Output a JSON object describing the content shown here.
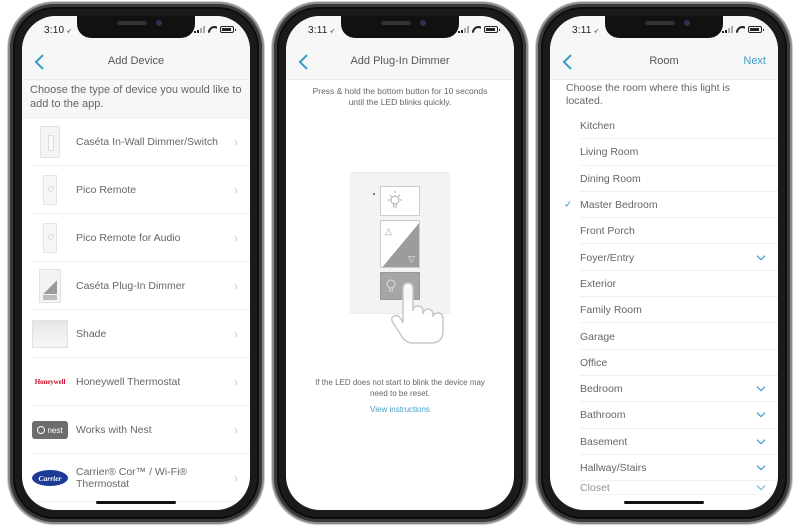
{
  "colors": {
    "accent": "#3a9ec9",
    "honeywell_red": "#c8102e",
    "carrier_blue": "#1d3b96"
  },
  "screens": [
    {
      "status": {
        "time": "3:10",
        "location_icon": "location-arrow-icon"
      },
      "nav": {
        "back_icon": "chevron-left-icon",
        "title": "Add Device"
      },
      "intro": "Choose the type of device you would like to add to the app.",
      "devices": [
        {
          "label": "Caséta In-Wall Dimmer/Switch",
          "icon": "wall-dimmer-icon"
        },
        {
          "label": "Pico Remote",
          "icon": "pico-remote-icon"
        },
        {
          "label": "Pico Remote for Audio",
          "icon": "pico-audio-icon"
        },
        {
          "label": "Caséta Plug-In Dimmer",
          "icon": "plug-in-dimmer-icon"
        },
        {
          "label": "Shade",
          "icon": "shade-icon"
        },
        {
          "label": "Honeywell Thermostat",
          "icon": "honeywell-logo",
          "logo_text": "Honeywell"
        },
        {
          "label": "Works with Nest",
          "icon": "nest-logo",
          "logo_text": "nest"
        },
        {
          "label": "Carrier® Cor™ / Wi-Fi® Thermostat",
          "icon": "carrier-logo",
          "logo_text": "Carrier"
        }
      ],
      "row_chevron": "›"
    },
    {
      "status": {
        "time": "3:11",
        "location_icon": "location-arrow-icon"
      },
      "nav": {
        "back_icon": "chevron-left-icon",
        "title": "Add Plug-In Dimmer"
      },
      "instruction": "Press & hold the bottom button for 10 seconds until the LED blinks quickly.",
      "device_symbols": {
        "up": "△",
        "down": "▽"
      },
      "reset_note": "If the LED does not start to blink the device may need to be reset.",
      "link": "View instructions"
    },
    {
      "status": {
        "time": "3:11",
        "location_icon": "location-arrow-icon"
      },
      "nav": {
        "back_icon": "chevron-left-icon",
        "title": "Room",
        "next": "Next"
      },
      "intro": "Choose the room where this light is located.",
      "check_glyph": "✓",
      "rooms": [
        {
          "label": "Kitchen",
          "selected": false,
          "expandable": false
        },
        {
          "label": "Living Room",
          "selected": false,
          "expandable": false
        },
        {
          "label": "Dining Room",
          "selected": false,
          "expandable": false
        },
        {
          "label": "Master Bedroom",
          "selected": true,
          "expandable": false
        },
        {
          "label": "Front Porch",
          "selected": false,
          "expandable": false
        },
        {
          "label": "Foyer/Entry",
          "selected": false,
          "expandable": true
        },
        {
          "label": "Exterior",
          "selected": false,
          "expandable": false
        },
        {
          "label": "Family Room",
          "selected": false,
          "expandable": false
        },
        {
          "label": "Garage",
          "selected": false,
          "expandable": false
        },
        {
          "label": "Office",
          "selected": false,
          "expandable": false
        },
        {
          "label": "Bedroom",
          "selected": false,
          "expandable": true
        },
        {
          "label": "Bathroom",
          "selected": false,
          "expandable": true
        },
        {
          "label": "Basement",
          "selected": false,
          "expandable": true
        },
        {
          "label": "Hallway/Stairs",
          "selected": false,
          "expandable": true
        },
        {
          "label": "Closet",
          "selected": false,
          "expandable": true
        }
      ]
    }
  ]
}
